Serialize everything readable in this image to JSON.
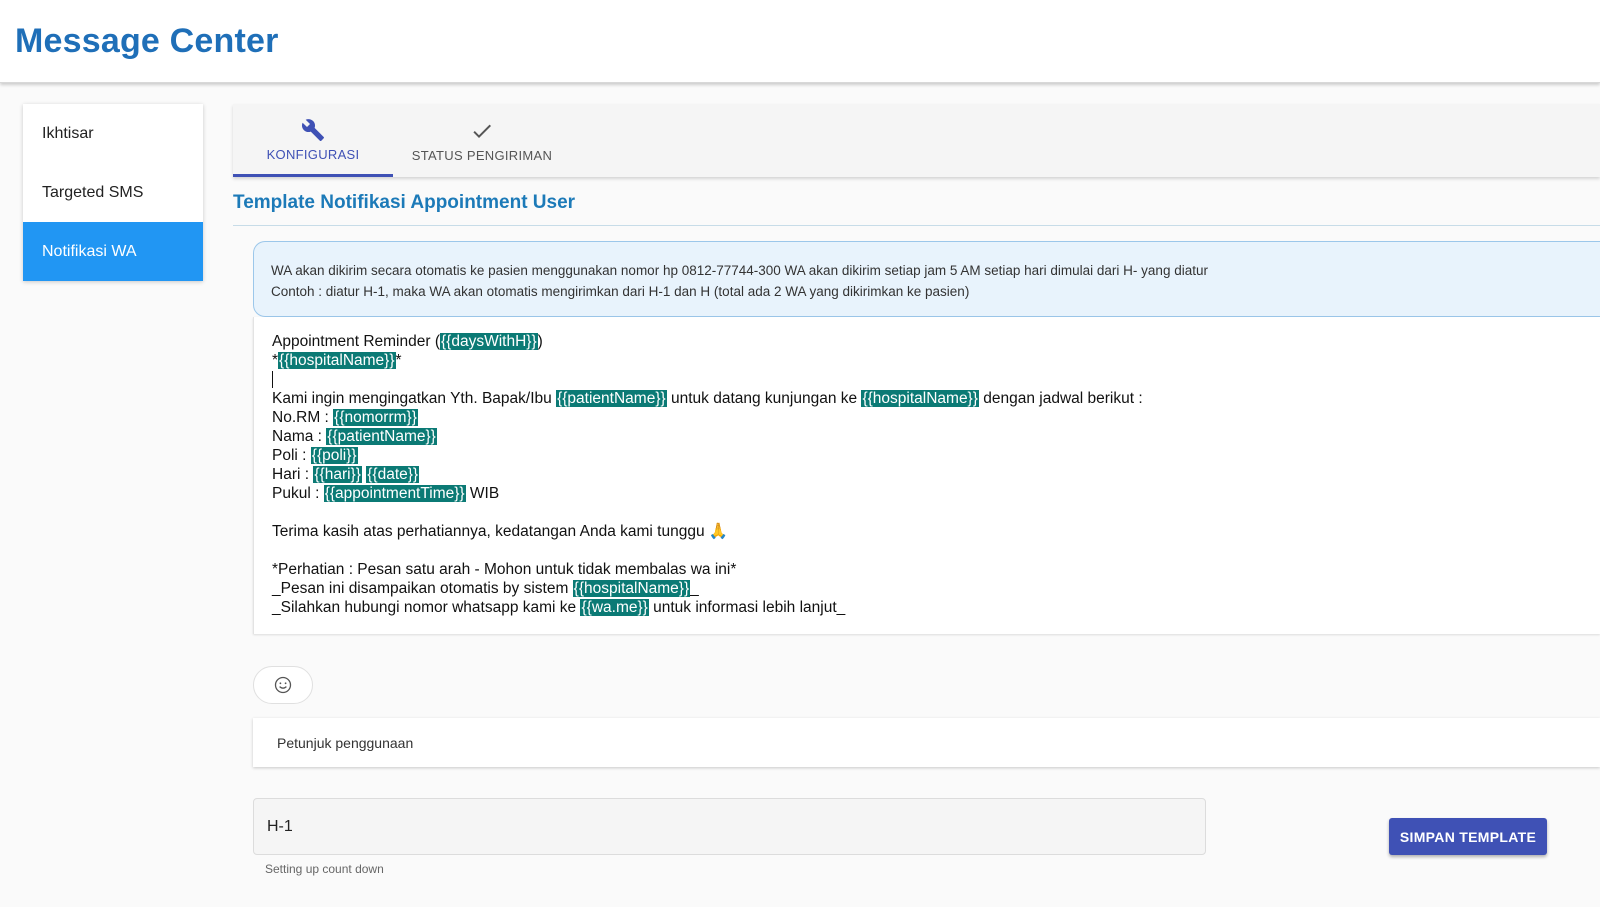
{
  "header": {
    "title": "Message Center"
  },
  "sidebar": {
    "items": [
      {
        "label": "Ikhtisar",
        "active": false
      },
      {
        "label": "Targeted SMS",
        "active": false
      },
      {
        "label": "Notifikasi WA",
        "active": true
      }
    ]
  },
  "tabs": [
    {
      "label": "KONFIGURASI",
      "icon": "wrench-icon",
      "active": true
    },
    {
      "label": "STATUS PENGIRIMAN",
      "icon": "check-icon",
      "active": false
    }
  ],
  "section": {
    "title": "Template Notifikasi Appointment User"
  },
  "info": {
    "line1": "WA akan dikirim secara otomatis ke pasien menggunakan nomor hp 0812-77744-300 WA akan dikirim setiap jam 5 AM setiap hari dimulai dari H- yang diatur",
    "line2": "Contoh : diatur H-1, maka WA akan otomatis mengirimkan dari H-1 dan H (total ada 2 WA yang dikirimkan ke pasien)"
  },
  "template": {
    "l1_pre": "Appointment Reminder (",
    "l1_token": "{{daysWithH}}",
    "l1_post": ")",
    "l2_pre": "*",
    "l2_token": "{{hospitalName}}",
    "l2_post": "*",
    "l4_pre": "Kami ingin mengingatkan Yth. Bapak/Ibu ",
    "l4_token1": "{{patientName}}",
    "l4_mid": " untuk datang kunjungan ke ",
    "l4_token2": "{{hospitalName}}",
    "l4_post": " dengan jadwal berikut :",
    "l5_pre": "No.RM : ",
    "l5_token": "{{nomorrm}}",
    "l6_pre": "Nama : ",
    "l6_token": "{{patientName}}",
    "l7_pre": "Poli : ",
    "l7_token": "{{poli}}",
    "l8_pre": "Hari : ",
    "l8_token1": "{{hari}}",
    "l8_mid": " ",
    "l8_token2": "{{date}}",
    "l9_pre": "Pukul : ",
    "l9_token": "{{appointmentTime}}",
    "l9_post": " WIB",
    "l11": "Terima kasih atas perhatiannya, kedatangan Anda kami tunggu 🙏",
    "l13": "*Perhatian : Pesan satu arah - Mohon untuk tidak membalas wa ini*",
    "l14_pre": "_Pesan ini disampaikan otomatis by sistem ",
    "l14_token": "{{hospitalName}}",
    "l14_post": "_",
    "l15_pre": "_Silahkan hubungi nomor whatsapp kami ke ",
    "l15_token": "{{wa.me}}",
    "l15_post": " untuk informasi lebih lanjut_"
  },
  "emoji_button": {
    "icon": "smiley-icon",
    "glyph": "☺"
  },
  "help": {
    "label": "Petunjuk penggunaan"
  },
  "countdown": {
    "value": "H-1",
    "hint": "Setting up count down"
  },
  "save_button": {
    "label": "SIMPAN TEMPLATE"
  },
  "colors": {
    "accent": "#3f51b5",
    "sidebar_active": "#2196f3",
    "title": "#1f6fb8",
    "token_bg": "#0b7a75",
    "info_bg": "#e8f3fc"
  }
}
